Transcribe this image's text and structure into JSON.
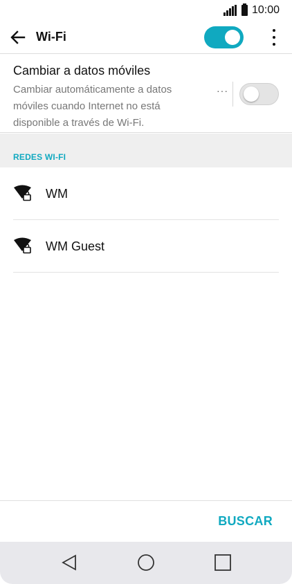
{
  "status_bar": {
    "time": "10:00",
    "icons": [
      "signal-icon",
      "battery-icon"
    ]
  },
  "app_bar": {
    "title": "Wi-Fi",
    "wifi_enabled": true,
    "icons": [
      "arrow-left-icon",
      "more-vert-icon"
    ]
  },
  "switch_to_mobile": {
    "title": "Cambiar a datos móviles",
    "description": "Cambiar automáticamente a datos móviles cuando Internet no está disponible a través de Wi-Fi.",
    "more_label": "···",
    "enabled": false
  },
  "networks_section": {
    "header": "REDES WI-FI",
    "networks": [
      {
        "name": "WM",
        "secured": true,
        "icon": "wifi-lock-icon"
      },
      {
        "name": "WM Guest",
        "secured": true,
        "icon": "wifi-lock-icon"
      }
    ]
  },
  "actions": {
    "scan_label": "BUSCAR"
  },
  "nav_bar": {
    "buttons": [
      "back-triangle-icon",
      "home-circle-icon",
      "recents-square-icon"
    ]
  },
  "colors": {
    "accent": "#10a9c0",
    "text": "#111111",
    "secondary_text": "#777777",
    "section_bg": "#efefef",
    "nav_bg": "#e8e8ec"
  }
}
